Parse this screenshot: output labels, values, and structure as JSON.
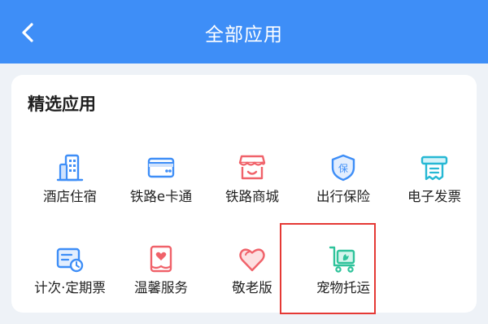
{
  "header": {
    "title": "全部应用",
    "back_icon": "chevron-left-icon",
    "background_color": "#3e8ef7"
  },
  "section": {
    "title": "精选应用",
    "apps": [
      {
        "label": "酒店住宿",
        "icon": "hotel-building-icon"
      },
      {
        "label": "铁路e卡通",
        "icon": "card-icon"
      },
      {
        "label": "铁路商城",
        "icon": "shop-icon"
      },
      {
        "label": "出行保险",
        "icon": "insurance-shield-icon"
      },
      {
        "label": "电子发票",
        "icon": "invoice-icon"
      },
      {
        "label": "计次·定期票",
        "icon": "ticket-clock-icon"
      },
      {
        "label": "温馨服务",
        "icon": "heart-service-icon"
      },
      {
        "label": "敬老版",
        "icon": "heart-icon"
      },
      {
        "label": "宠物托运",
        "icon": "pet-cart-icon"
      }
    ]
  },
  "colors": {
    "icon_blue": "#3e8ef7",
    "icon_red": "#f0626a",
    "icon_cyan": "#26b8d4",
    "icon_green": "#2fc39b",
    "highlight_border": "#e53935"
  }
}
